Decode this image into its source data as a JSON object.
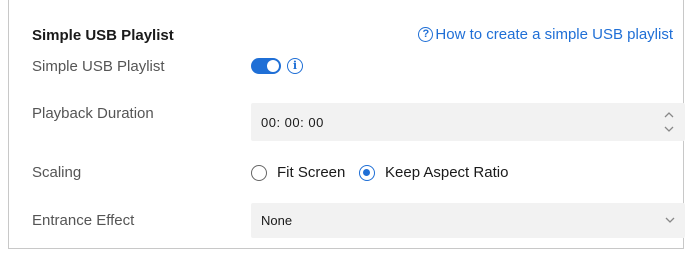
{
  "section": {
    "title": "Simple USB Playlist",
    "help_link": "How to create a simple USB playlist",
    "help_icon": "question-circle-icon"
  },
  "playlist_toggle": {
    "label": "Simple USB Playlist",
    "enabled": true,
    "info_glyph": "i",
    "accent_color": "#1f6fd6"
  },
  "playback_duration": {
    "label": "Playback Duration",
    "value": "00:  00:  00"
  },
  "scaling": {
    "label": "Scaling",
    "options": [
      "Fit Screen",
      "Keep Aspect Ratio"
    ],
    "selected": "Keep Aspect Ratio"
  },
  "entrance_effect": {
    "label": "Entrance Effect",
    "value": "None"
  }
}
